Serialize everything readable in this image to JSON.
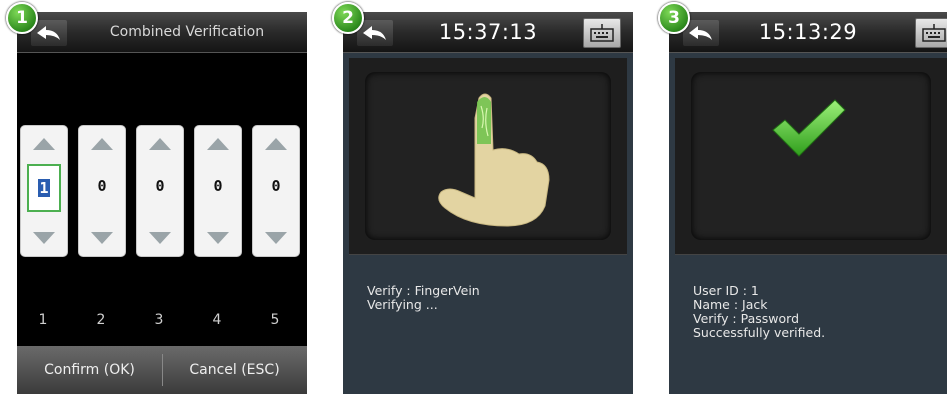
{
  "badges": [
    "1",
    "2",
    "3"
  ],
  "screen1": {
    "title": "Combined Verification",
    "digits": [
      "1",
      "0",
      "0",
      "0",
      "0"
    ],
    "column_numbers": [
      "1",
      "2",
      "3",
      "4",
      "5"
    ],
    "confirm_label": "Confirm (OK)",
    "cancel_label": "Cancel (ESC)"
  },
  "screen2": {
    "time": "15:37:13",
    "lines": [
      "Verify : FingerVein",
      "Verifying ..."
    ]
  },
  "screen3": {
    "time": "15:13:29",
    "lines": [
      "User ID : 1",
      "Name : Jack",
      "Verify : Password",
      "Successfully verified."
    ]
  },
  "colors": {
    "badge_green": "#3fa52a",
    "check_green": "#4cbf2a",
    "selected_border": "#4caf50"
  }
}
